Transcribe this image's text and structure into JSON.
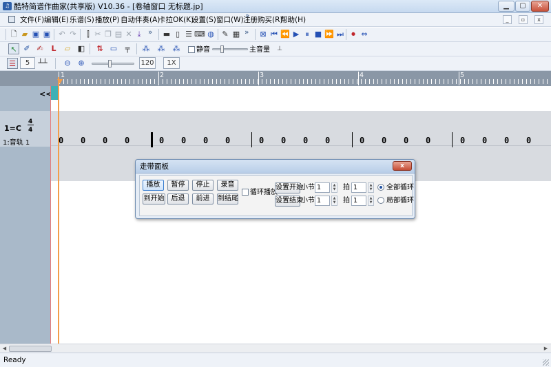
{
  "window": {
    "title": "酷特简谱作曲家(共享版) V10.36 - [卷轴窗口 无标题.jp]",
    "app_icon": "app-logo-icon",
    "controls": [
      "minimize-icon",
      "restore-icon",
      "close-icon"
    ]
  },
  "menu": {
    "items": [
      "文件(F)",
      "编辑(E)",
      "乐谱(S)",
      "播放(P)",
      "自动伴奏(A)",
      "卡拉OK(K)",
      "设置(S)",
      "窗口(W)",
      "注册购买(R)",
      "帮助(H)"
    ],
    "more": "»"
  },
  "toolbar": {
    "more": "»",
    "mute_label": "静音",
    "master_volume_label": "主音量",
    "step_value": "5",
    "tempo_value": "120",
    "speed_value": "1X"
  },
  "ruler": {
    "measures": [
      "1",
      "2",
      "3",
      "4",
      "5"
    ]
  },
  "track": {
    "collapse_label": "<<",
    "key": "1=C",
    "time_numerator": "4",
    "time_denominator": "4",
    "name": "1:音轨 1",
    "notes": [
      "0",
      "0",
      "0",
      "0",
      "0",
      "0",
      "0",
      "0",
      "0",
      "0",
      "0",
      "0",
      "0",
      "0",
      "0",
      "0",
      "0",
      "0",
      "0",
      "0"
    ]
  },
  "transport_panel": {
    "title": "走带面板",
    "close_label": "x",
    "buttons_row1": [
      "播放",
      "暂停",
      "停止",
      "录音"
    ],
    "buttons_row2": [
      "到开始",
      "后退",
      "前进",
      "到结尾"
    ],
    "loop_play_label": "循环播放",
    "set_start_label": "设置开始",
    "set_end_label": "设置结束",
    "measure_label": "小节",
    "beat_label": "拍",
    "start_measure": "1",
    "start_beat": "1",
    "end_measure": "1",
    "end_beat": "1",
    "loop_all_label": "全部循环",
    "loop_partial_label": "局部循环",
    "selected_loop": "全部循环"
  },
  "status": {
    "text": "Ready"
  }
}
